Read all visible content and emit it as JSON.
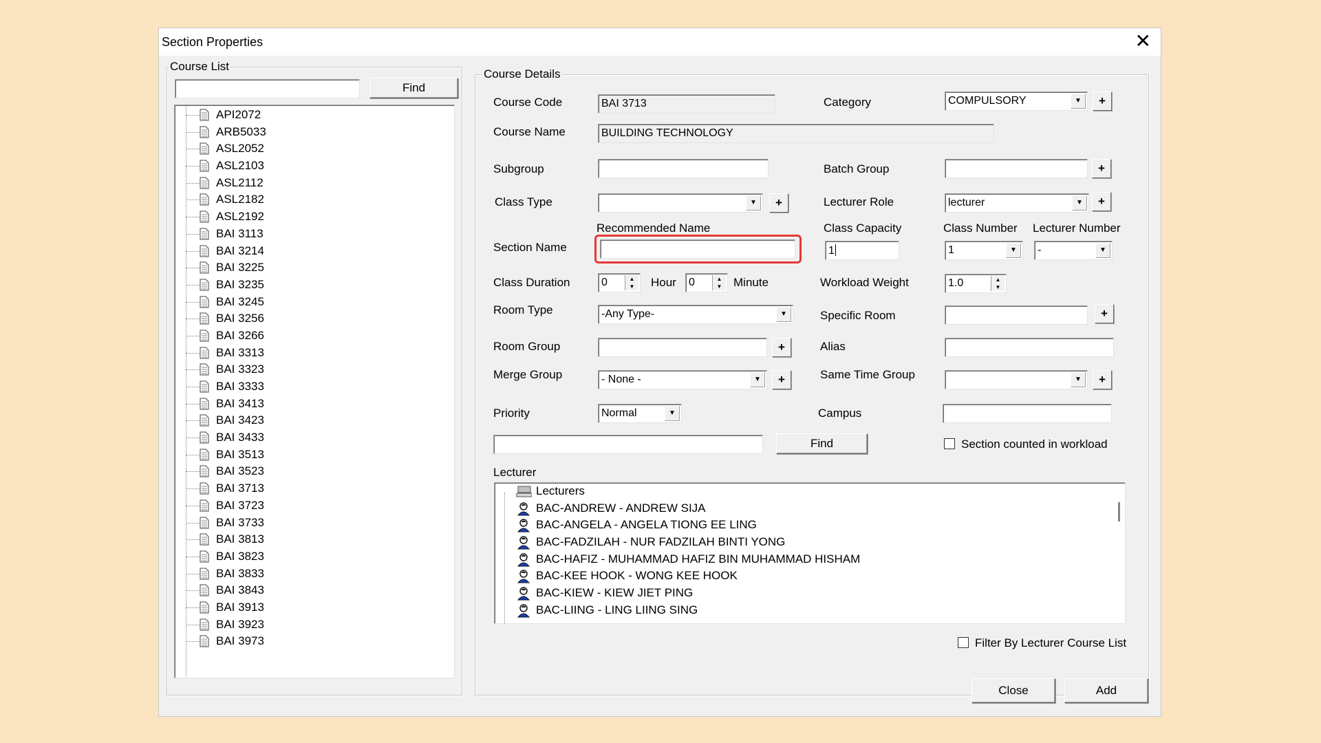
{
  "window": {
    "title": "Section Properties",
    "close_glyph": "✕"
  },
  "course_list": {
    "legend": "Course List",
    "search_value": "",
    "find_label": "Find",
    "items": [
      "API2072",
      "ARB5033",
      "ASL2052",
      "ASL2103",
      "ASL2112",
      "ASL2182",
      "ASL2192",
      "BAI 3113",
      "BAI 3214",
      "BAI 3225",
      "BAI 3235",
      "BAI 3245",
      "BAI 3256",
      "BAI 3266",
      "BAI 3313",
      "BAI 3323",
      "BAI 3333",
      "BAI 3413",
      "BAI 3423",
      "BAI 3433",
      "BAI 3513",
      "BAI 3523",
      "BAI 3713",
      "BAI 3723",
      "BAI 3733",
      "BAI 3813",
      "BAI 3823",
      "BAI 3833",
      "BAI 3843",
      "BAI 3913",
      "BAI 3923",
      "BAI 3973"
    ]
  },
  "details": {
    "legend": "Course Details",
    "course_code_label": "Course Code",
    "course_code_value": "BAI 3713",
    "course_name_label": "Course Name",
    "course_name_value": "BUILDING TECHNOLOGY",
    "category_label": "Category",
    "category_value": "COMPULSORY",
    "subgroup_label": "Subgroup",
    "subgroup_value": "",
    "batch_group_label": "Batch Group",
    "batch_group_value": "",
    "class_type_label": "Class Type",
    "class_type_value": "",
    "lecturer_role_label": "Lecturer Role",
    "lecturer_role_value": "lecturer",
    "recommended_name_label": "Recommended Name",
    "section_name_label": "Section Name",
    "section_name_value": "",
    "class_capacity_label": "Class Capacity",
    "class_capacity_value": "1",
    "class_number_label": "Class Number",
    "class_number_value": "1",
    "lecturer_number_label": "Lecturer Number",
    "lecturer_number_value": "-",
    "class_duration_label": "Class Duration",
    "duration_hour_value": "0",
    "hour_label": "Hour",
    "duration_minute_value": "0",
    "minute_label": "Minute",
    "workload_weight_label": "Workload Weight",
    "workload_weight_value": "1.0",
    "room_type_label": "Room Type",
    "room_type_value": "-Any Type-",
    "specific_room_label": "Specific Room",
    "specific_room_value": "",
    "room_group_label": "Room Group",
    "room_group_value": "",
    "alias_label": "Alias",
    "alias_value": "",
    "merge_group_label": "Merge Group",
    "merge_group_value": "- None -",
    "same_time_group_label": "Same Time Group",
    "same_time_group_value": "",
    "priority_label": "Priority",
    "priority_value": "Normal",
    "campus_label": "Campus",
    "campus_value": "",
    "lecturer_search_value": "",
    "find_label": "Find",
    "section_counted_label": "Section counted in workload",
    "section_counted_checked": false,
    "plus_glyph": "+",
    "dropdown_glyph": "▼",
    "spin_up_glyph": "▲",
    "spin_down_glyph": "▼"
  },
  "lecturer": {
    "label": "Lecturer",
    "root": "Lecturers",
    "items": [
      "BAC-ANDREW - ANDREW SIJA",
      "BAC-ANGELA - ANGELA TIONG EE LING",
      "BAC-FADZILAH - NUR FADZILAH BINTI YONG",
      "BAC-HAFIZ - MUHAMMAD HAFIZ BIN MUHAMMAD HISHAM",
      "BAC-KEE HOOK - WONG KEE HOOK",
      "BAC-KIEW - KIEW JIET PING",
      "BAC-LIING - LING LIING SING"
    ],
    "filter_label": "Filter By Lecturer Course List",
    "filter_checked": false
  },
  "footer": {
    "close_label": "Close",
    "add_label": "Add"
  },
  "colors": {
    "background": "#fbe4c0",
    "dialog": "#f0f0f0",
    "highlight": "#e53935"
  }
}
